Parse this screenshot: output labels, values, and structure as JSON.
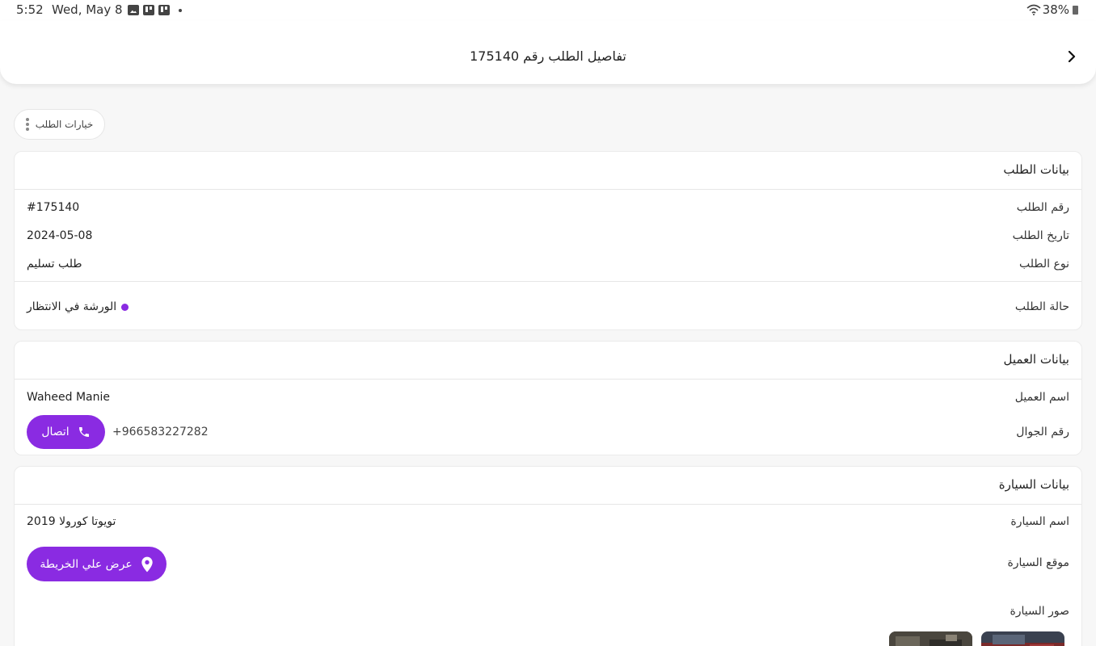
{
  "status_bar": {
    "time": "5:52",
    "date": "Wed, May 8",
    "battery": "38%"
  },
  "app_bar": {
    "title": "تفاصيل الطلب رقم  175140"
  },
  "order_options": {
    "label": "خيارات الطلب"
  },
  "order_card": {
    "title": "بيانات الطلب",
    "rows": [
      {
        "label": "رقم الطلب",
        "value": "#175140"
      },
      {
        "label": "تاريخ الطلب",
        "value": "2024-05-08"
      },
      {
        "label": "نوع الطلب",
        "value": "طلب تسليم"
      }
    ],
    "status_label": "حالة الطلب",
    "status_value": "الورشة في الانتظار"
  },
  "customer_card": {
    "title": "بيانات العميل",
    "name_label": "اسم العميل",
    "name_value": "Waheed Manie",
    "phone_label": "رقم الجوال",
    "phone_value": "+966583227282",
    "call_button": "اتصال"
  },
  "car_card": {
    "title": "بيانات السيارة",
    "name_label": "اسم السيارة",
    "name_value": "تويوتا كورولا 2019",
    "location_label": "موقع السيارة",
    "map_button": "عرض علي الخريطة",
    "photos_label": "صور السيارة"
  },
  "colors": {
    "accent": "#8a2be2",
    "background": "#f7f7f7",
    "card": "#ffffff"
  }
}
